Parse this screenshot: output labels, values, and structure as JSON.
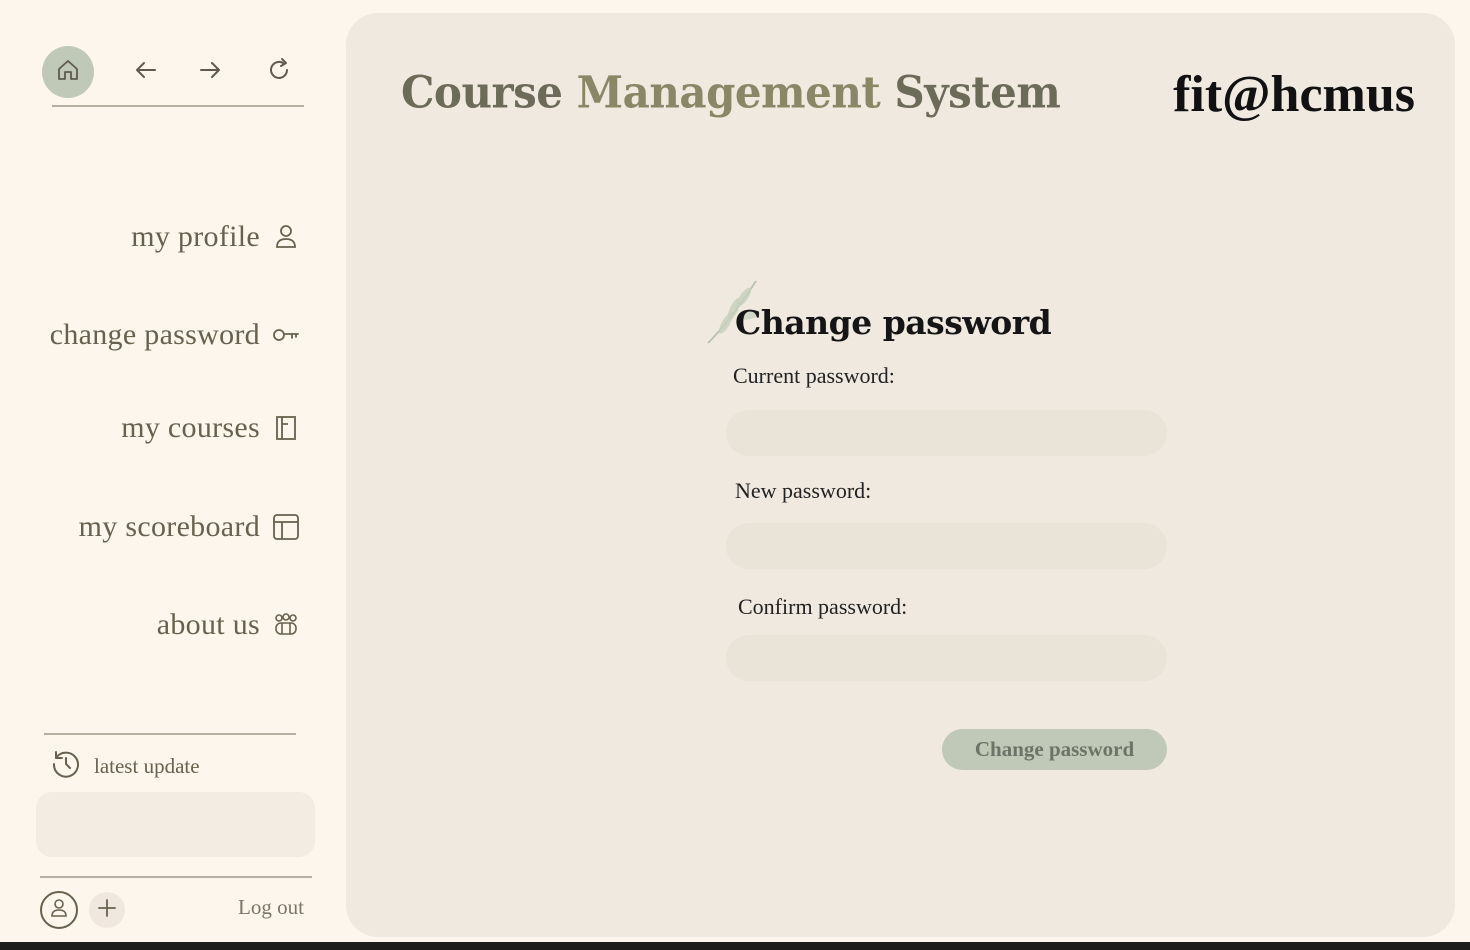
{
  "sidebar": {
    "nav": {
      "home_icon": "home-icon",
      "back_icon": "arrow-left-icon",
      "forward_icon": "arrow-right-icon",
      "reload_icon": "reload-icon"
    },
    "items": [
      {
        "label": "my profile",
        "icon": "user-icon"
      },
      {
        "label": "change password",
        "icon": "key-icon"
      },
      {
        "label": "my courses",
        "icon": "book-icon"
      },
      {
        "label": "my scoreboard",
        "icon": "table-icon"
      },
      {
        "label": "about us",
        "icon": "group-icon"
      }
    ],
    "latest_update": {
      "label": "latest update",
      "icon": "history-icon"
    },
    "footer": {
      "logout_label": "Log out"
    }
  },
  "header": {
    "title_part1": "Course ",
    "title_part2": "Management",
    "title_part3": " System",
    "brand": "fit@hcmus"
  },
  "form": {
    "title": "Change password",
    "current_label": "Current password:",
    "new_label": "New password:",
    "confirm_label": "Confirm password:",
    "current_value": "",
    "new_value": "",
    "confirm_value": "",
    "submit_label": "Change password"
  },
  "colors": {
    "page_bg": "#fcf6ec",
    "panel_bg": "#efe9df",
    "accent_sage": "#c0c9b7",
    "text_muted": "#66624f"
  }
}
